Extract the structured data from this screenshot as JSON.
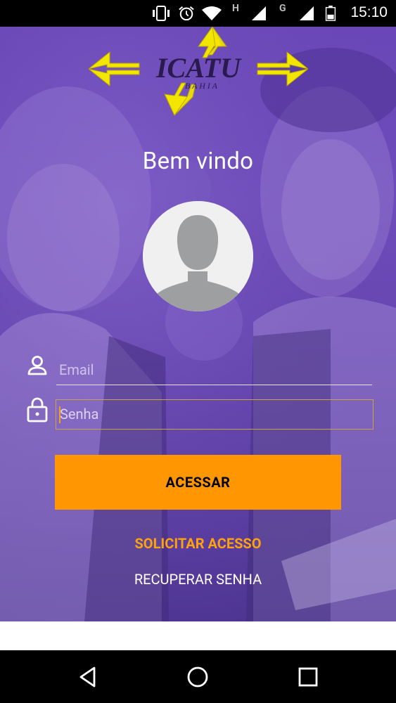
{
  "status_bar": {
    "time": "15:10",
    "icons": [
      "vibrate-icon",
      "alarm-icon",
      "wifi-icon",
      "signal-h-icon",
      "signal-g-icon",
      "battery-icon"
    ],
    "network_labels": {
      "h": "H",
      "g": "G"
    }
  },
  "logo": {
    "name": "ICATU",
    "subtitle": "B A H I A"
  },
  "welcome": "Bem vindo",
  "form": {
    "email_placeholder": "Email",
    "password_placeholder": "Senha"
  },
  "buttons": {
    "acessar": "ACESSAR",
    "solicitar": "SOLICITAR ACESSO",
    "recuperar": "RECUPERAR SENHA"
  },
  "colors": {
    "primary": "#ff9602",
    "accent_link": "#ffa20f",
    "focus_border": "#c9a243",
    "background": "#6a47b8"
  },
  "nav": [
    "back-icon",
    "home-icon",
    "recents-icon"
  ]
}
